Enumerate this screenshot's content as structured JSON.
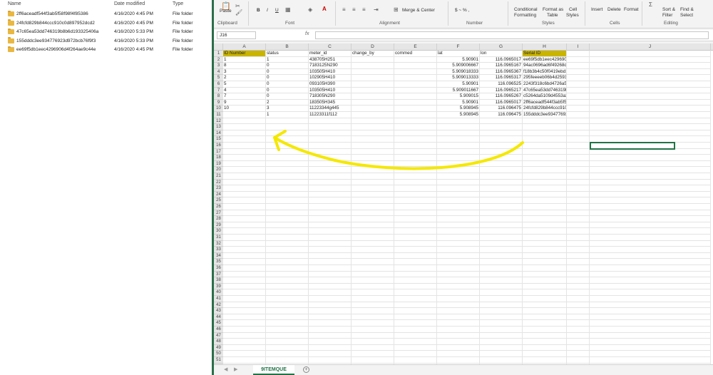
{
  "explorer": {
    "headers": {
      "name": "Name",
      "date": "Date modified",
      "type": "Type"
    },
    "files": [
      {
        "name": "2ff6aceadf544f3ab5f58f98f4f85386",
        "date": "4/16/2020 4:45 PM",
        "type": "File folder"
      },
      {
        "name": "24fcfd829b844ccc910c0d897952dcd2",
        "date": "4/16/2020 4:45 PM",
        "type": "File folder"
      },
      {
        "name": "47c65ea53dd746319b8b6d193325406a",
        "date": "4/16/2020 5:33 PM",
        "type": "File folder"
      },
      {
        "name": "155dddc3ee934776923d972bcb76f9f3",
        "date": "4/16/2020 5:33 PM",
        "type": "File folder"
      },
      {
        "name": "ee69f5db1eec4296906d4f264ae9c44e",
        "date": "4/16/2020 4:45 PM",
        "type": "File folder"
      }
    ]
  },
  "ribbon": {
    "paste": "Paste",
    "clipboard": "Clipboard",
    "font": "Font",
    "alignment": "Alignment",
    "merge_center": "Merge & Center",
    "number": "Number",
    "number_format": "$  ~  %  ,",
    "conditional": "Conditional",
    "formatting": "Formatting",
    "format_as": "Format as",
    "table": "Table",
    "cell": "Cell",
    "styles_btn": "Styles",
    "styles": "Styles",
    "insert": "Insert",
    "delete": "Delete",
    "format": "Format",
    "cells": "Cells",
    "sort_filter_1": "Sort &",
    "sort_filter_2": "Filter",
    "find_select_1": "Find &",
    "find_select_2": "Select",
    "editing": "Editing",
    "bold": "B",
    "italic": "I",
    "underline": "U"
  },
  "formula": {
    "namebox": "J16",
    "fx": "fx",
    "value": ""
  },
  "columns": [
    "A",
    "B",
    "C",
    "D",
    "E",
    "F",
    "G",
    "H",
    "I",
    "J"
  ],
  "rows": [
    [
      "ID Number",
      "status",
      "meter_id",
      "change_by",
      "commed",
      "lat",
      "lon",
      "Serial ID",
      "",
      ""
    ],
    [
      "1",
      "1",
      "438705H251",
      "",
      "",
      "5.90901",
      "116.0965017",
      "ee69f5db1eec4296906d4f264ae9c44e",
      "",
      ""
    ],
    [
      "8",
      "0",
      "7183125N290",
      "",
      "",
      "5.909006667",
      "116.0965167",
      "94ac0696ad6f49268d464650b8661aa4",
      "",
      ""
    ],
    [
      "3",
      "0",
      "103505H410",
      "",
      "",
      "5.909018333",
      "116.0965367",
      "f18b3b4c50f0419ebd1c7dcf12d7cfc2",
      "",
      ""
    ],
    [
      "2",
      "0",
      "102905H410",
      "",
      "",
      "5.909013333",
      "116.0965317",
      "295feeeeb06b4d25930a9bcf66f554e8",
      "",
      ""
    ],
    [
      "5",
      "0",
      "093105H390",
      "",
      "",
      "5.90901",
      "116.096525",
      "2243f318c6bd4726a5b9184458c7e1ec",
      "",
      ""
    ],
    [
      "4",
      "0",
      "103505H410",
      "",
      "",
      "5.909011667",
      "116.0965217",
      "47c65ea53dd746319b8b6d193325406a",
      "",
      ""
    ],
    [
      "7",
      "0",
      "718305N290",
      "",
      "",
      "5.909015",
      "116.0965267",
      "c5264da5109d4553a3fa56fdc005fc90",
      "",
      ""
    ],
    [
      "9",
      "2",
      "183505H345",
      "",
      "",
      "5.90901",
      "116.0965017",
      "2ff6aceadf544f3ab5f58f98f4f85386",
      "",
      ""
    ],
    [
      "10",
      "3",
      "11223344g445",
      "",
      "",
      "5.908945",
      "116.096475",
      "24fcfd829b844ccc910c0d897952dcd2",
      "",
      ""
    ],
    [
      "",
      "1",
      "11223311f112",
      "",
      "",
      "5.908945",
      "116.096475",
      "155dddc3ee934776923d972bcb76f9f3",
      "",
      ""
    ]
  ],
  "row_count": 53,
  "sheet_tab": "9ITEMQUE",
  "add_sheet": "+",
  "colors": {
    "highlight": "#c9b400",
    "excel_green": "#217346",
    "arrow": "#f5e800"
  }
}
